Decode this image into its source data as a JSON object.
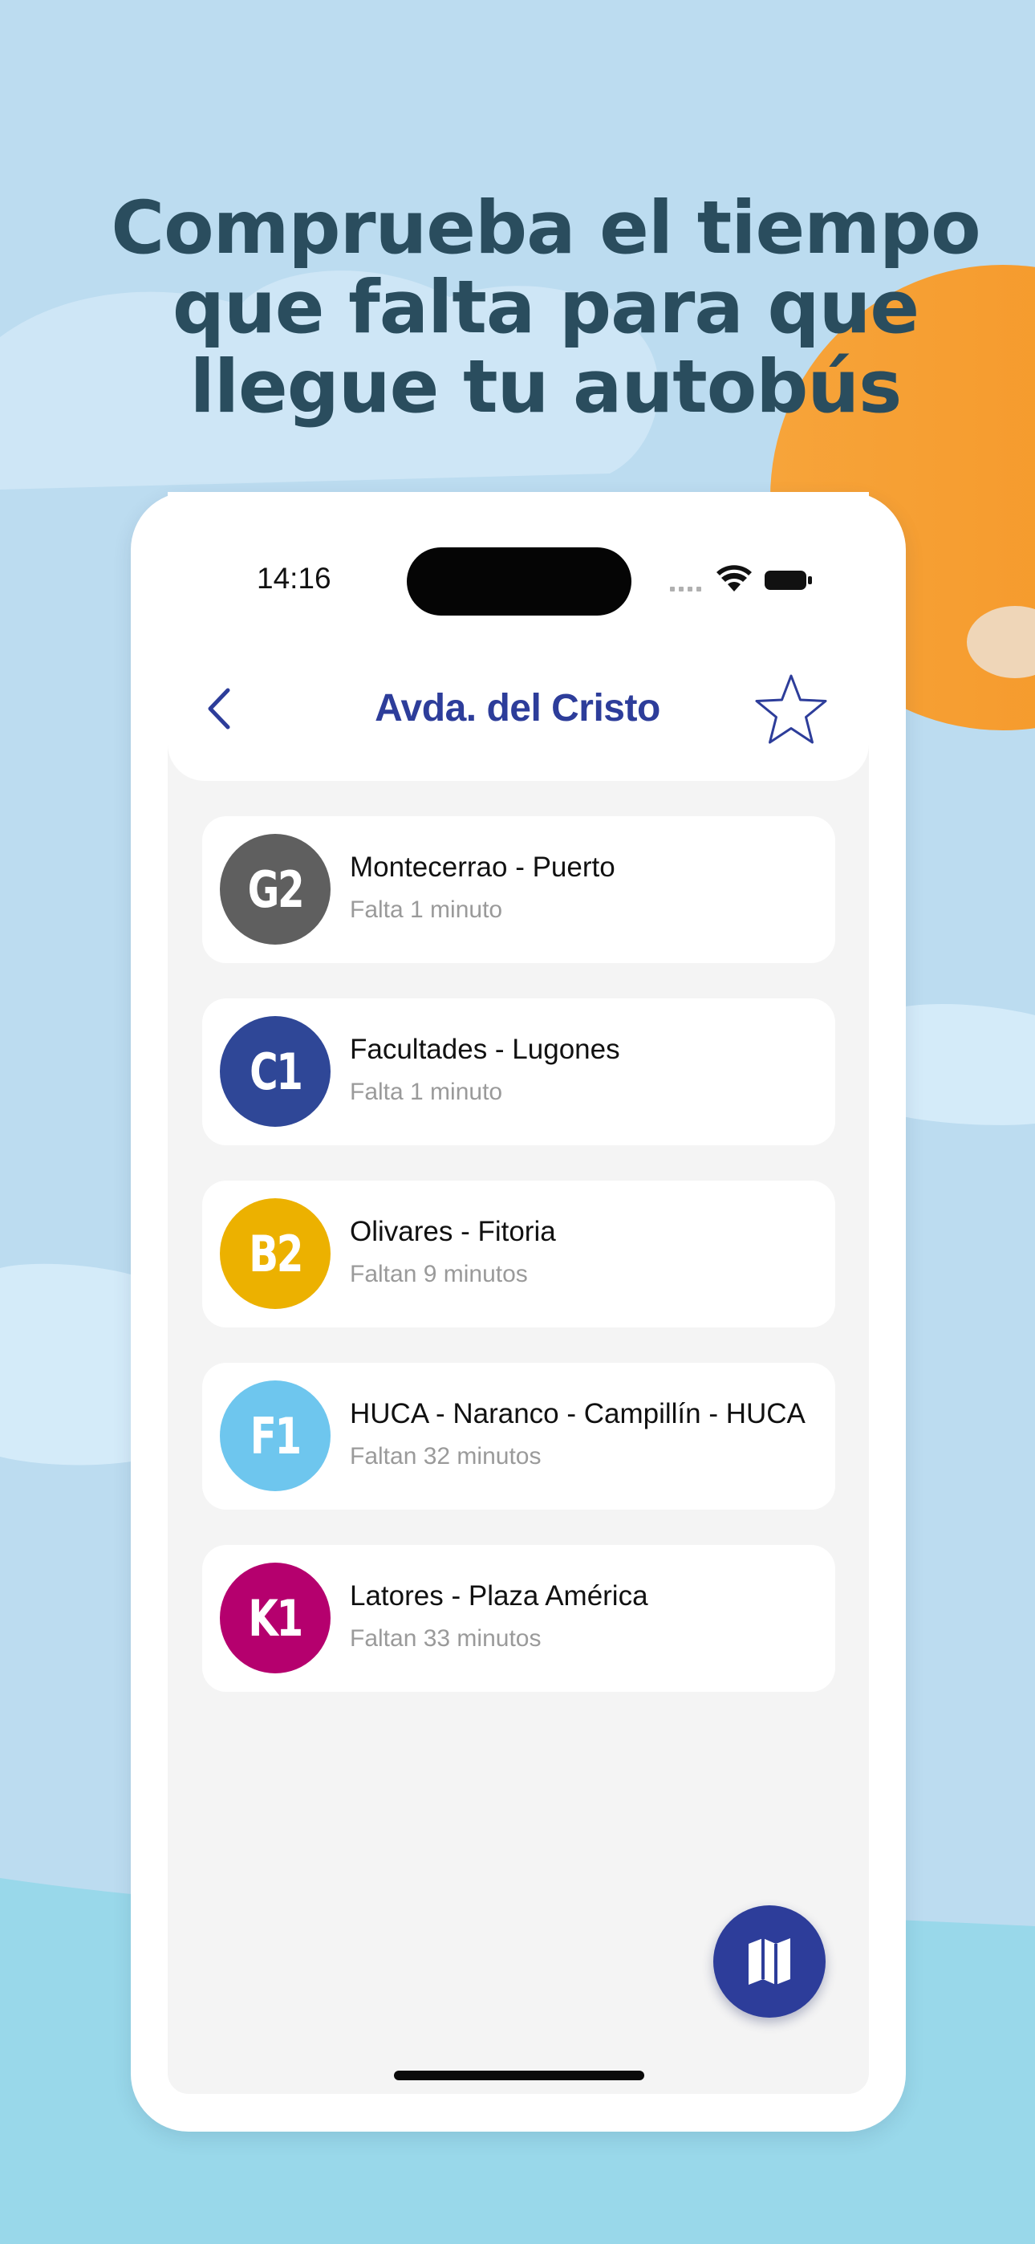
{
  "promo": {
    "headline_lines": [
      "Comprueba el tiempo",
      "que falta para que",
      "llegue tu autobús"
    ]
  },
  "status_bar": {
    "time": "14:16",
    "icons": [
      "cellular-icon",
      "wifi-icon",
      "battery-icon"
    ]
  },
  "nav": {
    "title": "Avda. del Cristo",
    "back_icon": "chevron-left-icon",
    "favorite_icon": "star-outline-icon"
  },
  "lines": [
    {
      "code": "G2",
      "name": "Montecerrao - Puerto",
      "eta": "Falta 1 minuto",
      "color": "#5f5f5f"
    },
    {
      "code": "C1",
      "name": "Facultades - Lugones",
      "eta": "Falta 1 minuto",
      "color": "#2f4797"
    },
    {
      "code": "B2",
      "name": "Olivares - Fitoria",
      "eta": "Faltan 9 minutos",
      "color": "#ecb100"
    },
    {
      "code": "F1",
      "name": "HUCA - Naranco - Campillín - HUCA",
      "eta": "Faltan 32 minutos",
      "color": "#6ec6ee"
    },
    {
      "code": "K1",
      "name": "Latores - Plaza América",
      "eta": "Faltan 33 minutos",
      "color": "#b5006e"
    }
  ],
  "map_button": {
    "icon": "map-icon"
  },
  "colors": {
    "accent": "#2d3d9a",
    "headline": "#2a4d5e",
    "background_sky": "#bcdcf0",
    "sun": "#f5a23a"
  }
}
